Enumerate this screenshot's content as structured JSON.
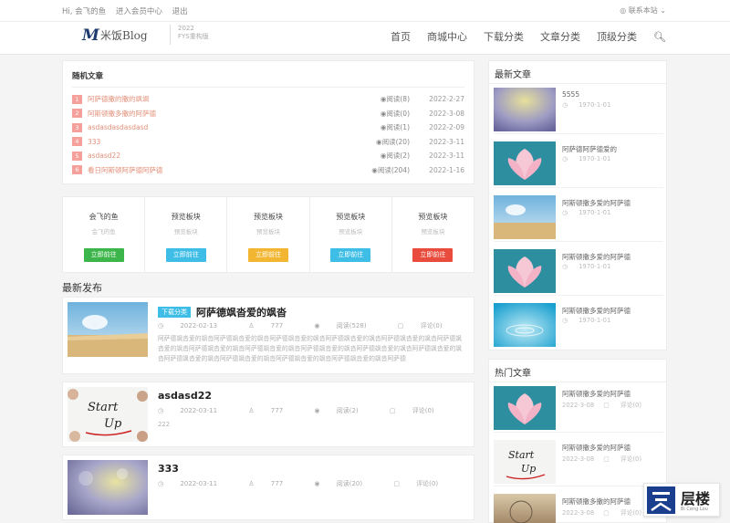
{
  "topbar": {
    "greeting": "Hi, 会飞的鱼",
    "member_center": "进入会员中心",
    "logout": "退出",
    "contact": "联系本站"
  },
  "brand": {
    "logo_text": "米饭Blog",
    "sub_line1": "2022",
    "sub_line2": "FYS重构版"
  },
  "nav": {
    "items": [
      "首页",
      "商城中心",
      "下载分类",
      "文章分类",
      "顶级分类"
    ]
  },
  "random": {
    "title": "随机文章",
    "rows": [
      {
        "num": "1",
        "title": "阿萨德撒的撒的飒飒",
        "reads": "阅读(8)",
        "date": "2022-2-27"
      },
      {
        "num": "2",
        "title": "阿斯顿撒多撒的阿萨德",
        "reads": "阅读(0)",
        "date": "2022-3-08"
      },
      {
        "num": "3",
        "title": "asdasdasdasdasd",
        "reads": "阅读(1)",
        "date": "2022-2-09"
      },
      {
        "num": "4",
        "title": "333",
        "reads": "阅读(20)",
        "date": "2022-3-11"
      },
      {
        "num": "5",
        "title": "asdasd22",
        "reads": "阅读(2)",
        "date": "2022-3-11"
      },
      {
        "num": "6",
        "title": "看日阿斯顿阿萨德阿萨德",
        "reads": "阅读(204)",
        "date": "2022-1-16"
      }
    ]
  },
  "blocks": [
    {
      "title": "会飞的鱼",
      "sub": "会飞的鱼",
      "btn": "立即前往",
      "color": "#3cb54a"
    },
    {
      "title": "预览板块",
      "sub": "预览板块",
      "btn": "立即前往",
      "color": "#3ebde6"
    },
    {
      "title": "预览板块",
      "sub": "预览板块",
      "btn": "立即前往",
      "color": "#f2b632"
    },
    {
      "title": "预览板块",
      "sub": "预览板块",
      "btn": "立即前往",
      "color": "#3ebde6"
    },
    {
      "title": "预览板块",
      "sub": "预览板块",
      "btn": "立即前往",
      "color": "#e94b3c"
    }
  ],
  "latest": {
    "title": "最新发布",
    "posts": [
      {
        "badge": "下载分类",
        "title": "阿萨德飒沓爱的飒沓",
        "date": "2022-02-13",
        "author": "777",
        "reads": "阅读(528)",
        "comments": "评论(0)",
        "excerpt": "阿萨德飒沓爱的飒沓阿萨德飒沓爱的飒沓阿萨德飒沓爱的飒沓阿萨德飒沓爱的飒沓阿萨德飒沓爱的飒沓阿萨德飒沓爱的飒沓阿萨德飒沓爱的飒沓阿萨德飒沓爱的飒沓阿萨德飒沓爱的飒沓阿萨德飒沓爱的飒沓阿萨德飒沓爱的飒沓阿萨德飒沓爱的飒沓阿萨德飒沓爱的飒沓阿萨德飒沓爱的飒沓阿萨德飒沓爱的飒沓阿萨德"
      },
      {
        "badge": "",
        "title": "asdasd22",
        "date": "2022-03-11",
        "author": "777",
        "reads": "阅读(2)",
        "comments": "评论(0)",
        "excerpt": "222"
      },
      {
        "badge": "",
        "title": "333",
        "date": "2022-03-11",
        "author": "777",
        "reads": "阅读(20)",
        "comments": "评论(0)",
        "excerpt": ""
      }
    ]
  },
  "sidebar_latest": {
    "title": "最新文章",
    "items": [
      {
        "title": "5555",
        "date": "1970-1-01"
      },
      {
        "title": "阿萨德阿萨德爱的",
        "date": "1970-1-01"
      },
      {
        "title": "阿斯顿撒多爱的阿萨德",
        "date": "1970-1-01"
      },
      {
        "title": "阿斯顿撒多爱的阿萨德",
        "date": "1970-1-01"
      },
      {
        "title": "阿斯顿撒多爱的阿萨德",
        "date": "1970-1-01"
      }
    ]
  },
  "sidebar_hot": {
    "title": "热门文章",
    "items": [
      {
        "title": "阿斯顿撒多爱的阿萨德",
        "date": "2022-3-08",
        "comments": "评论(0)"
      },
      {
        "title": "阿斯顿撒多爱的阿萨德",
        "date": "2022-3-08",
        "comments": "评论(0)"
      },
      {
        "title": "阿斯顿撒多撒的阿萨德",
        "date": "2022-3-08",
        "comments": "评论(0)"
      }
    ]
  },
  "watermark": {
    "text": "层楼",
    "sub": "Bi Ceng Lou"
  }
}
